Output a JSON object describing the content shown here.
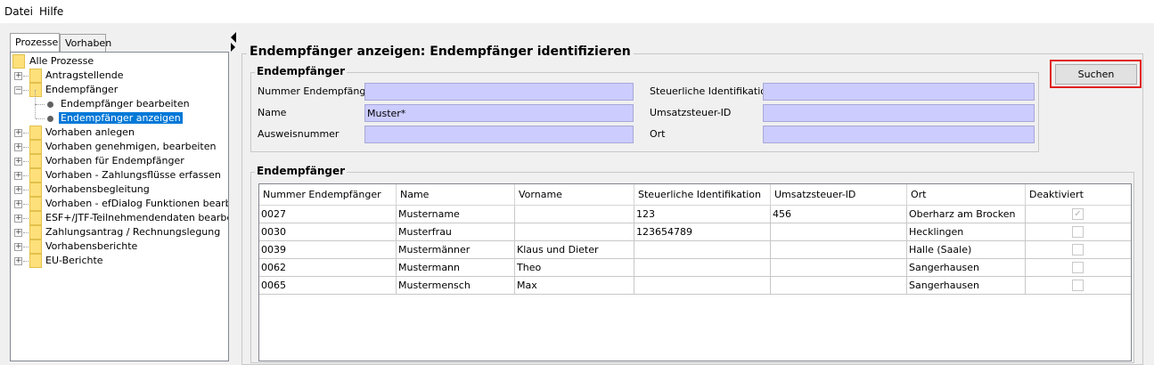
{
  "menu": {
    "items": [
      "Datei",
      "Hilfe"
    ]
  },
  "left_tabs": [
    "Prozesse",
    "Vorhaben"
  ],
  "tree": {
    "root": "Alle Prozesse",
    "items": [
      {
        "label": "Antragstellende",
        "expander": "+"
      },
      {
        "label": "Endempfänger",
        "expander": "−"
      },
      {
        "label": "Endempfänger bearbeiten",
        "child": true
      },
      {
        "label": "Endempfänger anzeigen",
        "child": true,
        "selected": true
      },
      {
        "label": "Vorhaben anlegen",
        "expander": "+"
      },
      {
        "label": "Vorhaben genehmigen, bearbeiten",
        "expander": "+"
      },
      {
        "label": "Vorhaben für Endempfänger",
        "expander": "+"
      },
      {
        "label": "Vorhaben - Zahlungsflüsse erfassen",
        "expander": "+"
      },
      {
        "label": "Vorhabensbegleitung",
        "expander": "+"
      },
      {
        "label": "Vorhaben - efDialog Funktionen bearbeiten",
        "expander": "+"
      },
      {
        "label": "ESF+/JTF-Teilnehmendendaten bearbeiten",
        "expander": "+"
      },
      {
        "label": "Zahlungsantrag / Rechnungslegung",
        "expander": "+"
      },
      {
        "label": "Vorhabensberichte",
        "expander": "+"
      },
      {
        "label": "EU-Berichte",
        "expander": "+"
      }
    ]
  },
  "main": {
    "title": "Endempfänger anzeigen: Endempfänger identifizieren",
    "search_group": "Endempfänger",
    "fields": {
      "nummer": {
        "label": "Nummer Endempfänger",
        "value": ""
      },
      "name": {
        "label": "Name",
        "value": "Muster*"
      },
      "ausweis": {
        "label": "Ausweisnummer",
        "value": ""
      },
      "steuer": {
        "label": "Steuerliche Identifikation",
        "value": ""
      },
      "ust": {
        "label": "Umsatzsteuer-ID",
        "value": ""
      },
      "ort": {
        "label": "Ort",
        "value": ""
      }
    },
    "search_button": "Suchen",
    "results_group": "Endempfänger"
  },
  "table": {
    "columns": [
      "Nummer Endempfänger",
      "Name",
      "Vorname",
      "Steuerliche Identifikation",
      "Umsatzsteuer-ID",
      "Ort",
      "Deaktiviert"
    ],
    "rows": [
      {
        "nummer": "0027",
        "name": "Mustername",
        "vorname": "",
        "steuer": "123",
        "ust": "456",
        "ort": "Oberharz am Brocken",
        "deaktiviert": true
      },
      {
        "nummer": "0030",
        "name": "Musterfrau",
        "vorname": "",
        "steuer": "123654789",
        "ust": "",
        "ort": "Hecklingen",
        "deaktiviert": false
      },
      {
        "nummer": "0039",
        "name": "Mustermänner",
        "vorname": "Klaus und Dieter",
        "steuer": "",
        "ust": "",
        "ort": "Halle (Saale)",
        "deaktiviert": false
      },
      {
        "nummer": "0062",
        "name": "Mustermann",
        "vorname": "Theo",
        "steuer": "",
        "ust": "",
        "ort": "Sangerhausen",
        "deaktiviert": false
      },
      {
        "nummer": "0065",
        "name": "Mustermensch",
        "vorname": "Max",
        "steuer": "",
        "ust": "",
        "ort": "Sangerhausen",
        "deaktiviert": false
      }
    ]
  }
}
